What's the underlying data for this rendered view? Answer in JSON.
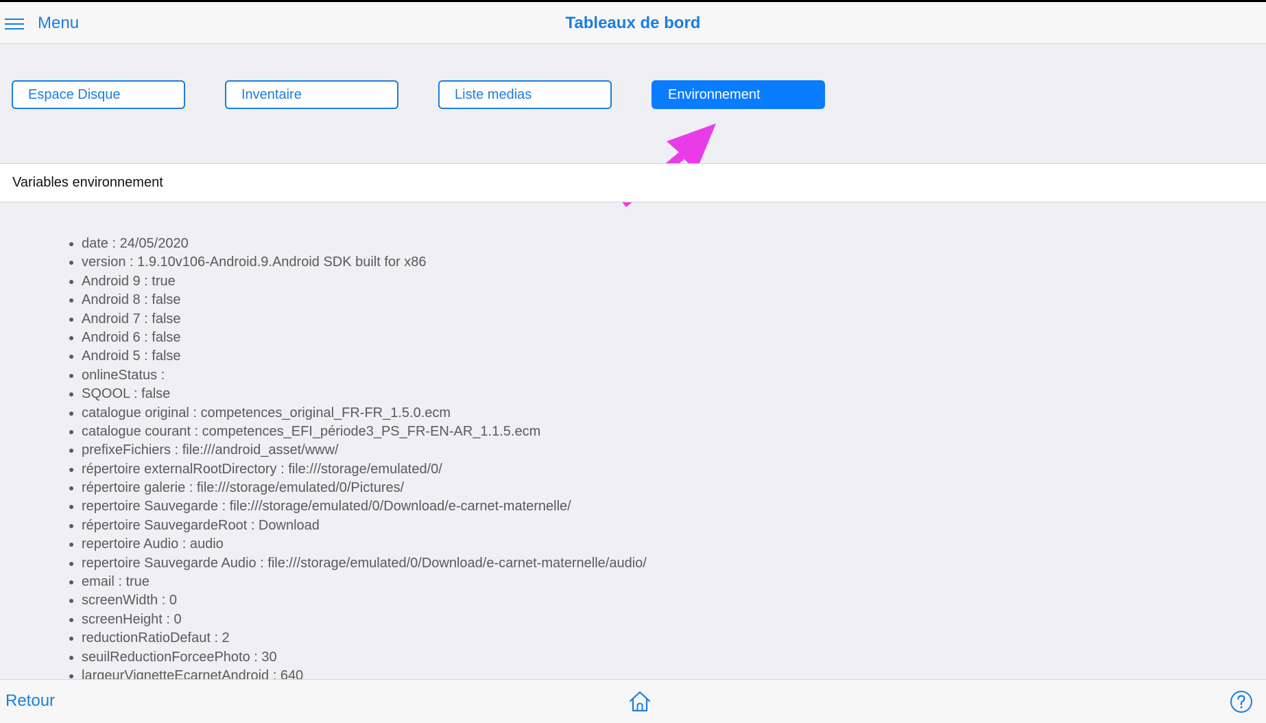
{
  "header": {
    "menu_label": "Menu",
    "title": "Tableaux de bord"
  },
  "tabs": [
    {
      "label": "Espace Disque",
      "active": false
    },
    {
      "label": "Inventaire",
      "active": false
    },
    {
      "label": "Liste medias",
      "active": false
    },
    {
      "label": "Environnement",
      "active": true
    }
  ],
  "section": {
    "title": "Variables environnement"
  },
  "env_items": [
    "date : 24/05/2020",
    "version : 1.9.10v106-Android.9.Android SDK built for x86",
    "Android 9 : true",
    "Android 8 : false",
    "Android 7 : false",
    "Android 6 : false",
    "Android 5 : false",
    "onlineStatus :",
    "SQOOL : false",
    "catalogue original : competences_original_FR-FR_1.5.0.ecm",
    "catalogue courant : competences_EFI_période3_PS_FR-EN-AR_1.1.5.ecm",
    "prefixeFichiers : file:///android_asset/www/",
    "répertoire externalRootDirectory : file:///storage/emulated/0/",
    "répertoire galerie : file:///storage/emulated/0/Pictures/",
    "repertoire Sauvegarde : file:///storage/emulated/0/Download/e-carnet-maternelle/",
    "répertoire SauvegardeRoot : Download",
    "repertoire Audio : audio",
    "repertoire Sauvegarde Audio : file:///storage/emulated/0/Download/e-carnet-maternelle/audio/",
    "email : true",
    "screenWidth : 0",
    "screenHeight : 0",
    "reductionRatioDefaut : 2",
    "seuilReductionForceePhoto : 30",
    "largeurVignetteEcarnetAndroid : 640"
  ],
  "footer": {
    "back_label": "Retour"
  },
  "icons": {
    "menu": "hamburger-icon",
    "home": "home-icon",
    "help": "help-icon",
    "annotation": "arrow-annotation"
  },
  "colors": {
    "accent": "#1a7ee0",
    "active_tab": "#0a7cff",
    "annotation_arrow": "#e93ce8"
  }
}
